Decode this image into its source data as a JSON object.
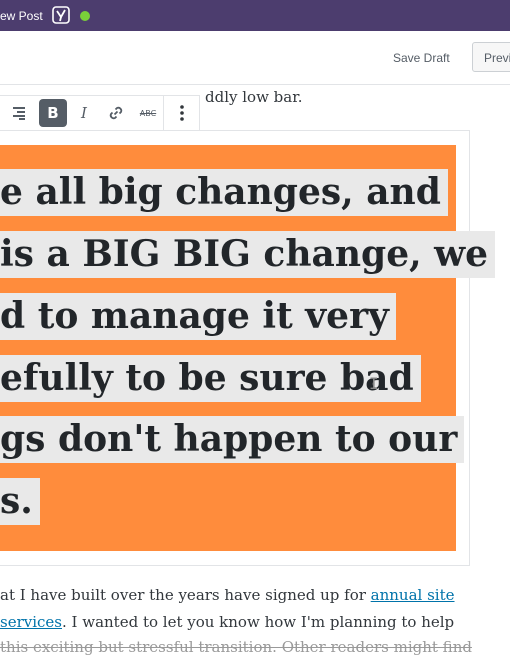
{
  "adminbar": {
    "new_post_label": "ew Post",
    "status_color": "#7ad03a"
  },
  "header": {
    "save_draft_label": "Save Draft",
    "preview_label": "Previ"
  },
  "editor": {
    "top_line": "ddly low bar.",
    "toolbar": {
      "align_icon": "align-right-icon",
      "bold_label": "B",
      "italic_label": "I",
      "link_icon": "link-icon",
      "strike_label": "ABC",
      "more_icon": "more-vertical-icon"
    },
    "highlight_block": {
      "background": "#ff8c3c",
      "lines": [
        "e all big changes, and",
        " is a BIG BIG change, we",
        "d to manage it very",
        "efully to be sure bad",
        "gs don't happen to our",
        "s."
      ]
    },
    "paragraph": {
      "line1_text": "at I have built over the years have signed up for ",
      "line1_link": "annual site ",
      "line2_link": " services",
      "line2_text": ".  I wanted to let you know how I'm planning to help",
      "line3_text": " this exciting but stressful transition.  Other readers might find"
    }
  }
}
